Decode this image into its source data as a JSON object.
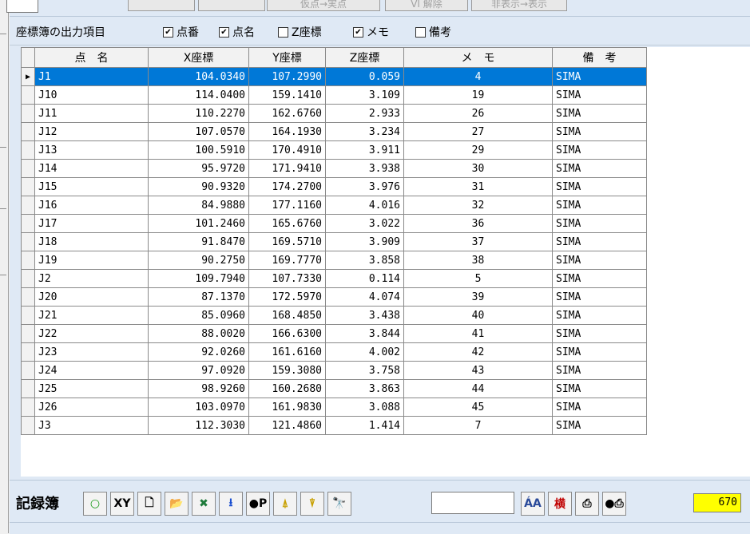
{
  "topbar": {
    "buttons": [
      "",
      "",
      "仮点→実点",
      "VI 解除",
      "非表示→表示"
    ]
  },
  "options": {
    "label": "座標簿の出力項目",
    "items": [
      {
        "label": "点番",
        "checked": true
      },
      {
        "label": "点名",
        "checked": true
      },
      {
        "label": "Z座標",
        "checked": false
      },
      {
        "label": "メモ",
        "checked": true
      },
      {
        "label": "備考",
        "checked": false
      }
    ]
  },
  "grid": {
    "headers": [
      "点　名",
      "X座標",
      "Y座標",
      "Z座標",
      "メ　モ",
      "備　考"
    ],
    "selected_indicator": "▶",
    "rows": [
      [
        "J1",
        "104.0340",
        "107.2990",
        "0.059",
        "4",
        "SIMA"
      ],
      [
        "J10",
        "114.0400",
        "159.1410",
        "3.109",
        "19",
        "SIMA"
      ],
      [
        "J11",
        "110.2270",
        "162.6760",
        "2.933",
        "26",
        "SIMA"
      ],
      [
        "J12",
        "107.0570",
        "164.1930",
        "3.234",
        "27",
        "SIMA"
      ],
      [
        "J13",
        "100.5910",
        "170.4910",
        "3.911",
        "29",
        "SIMA"
      ],
      [
        "J14",
        "95.9720",
        "171.9410",
        "3.938",
        "30",
        "SIMA"
      ],
      [
        "J15",
        "90.9320",
        "174.2700",
        "3.976",
        "31",
        "SIMA"
      ],
      [
        "J16",
        "84.9880",
        "177.1160",
        "4.016",
        "32",
        "SIMA"
      ],
      [
        "J17",
        "101.2460",
        "165.6760",
        "3.022",
        "36",
        "SIMA"
      ],
      [
        "J18",
        "91.8470",
        "169.5710",
        "3.909",
        "37",
        "SIMA"
      ],
      [
        "J19",
        "90.2750",
        "169.7770",
        "3.858",
        "38",
        "SIMA"
      ],
      [
        "J2",
        "109.7940",
        "107.7330",
        "0.114",
        "5",
        "SIMA"
      ],
      [
        "J20",
        "87.1370",
        "172.5970",
        "4.074",
        "39",
        "SIMA"
      ],
      [
        "J21",
        "85.0960",
        "168.4850",
        "3.438",
        "40",
        "SIMA"
      ],
      [
        "J22",
        "88.0020",
        "166.6300",
        "3.844",
        "41",
        "SIMA"
      ],
      [
        "J23",
        "92.0260",
        "161.6160",
        "4.002",
        "42",
        "SIMA"
      ],
      [
        "J24",
        "97.0920",
        "159.3080",
        "3.758",
        "43",
        "SIMA"
      ],
      [
        "J25",
        "98.9260",
        "160.2680",
        "3.863",
        "44",
        "SIMA"
      ],
      [
        "J26",
        "103.0970",
        "161.9830",
        "3.088",
        "45",
        "SIMA"
      ],
      [
        "J3",
        "112.3030",
        "121.4860",
        "1.414",
        "7",
        "SIMA"
      ]
    ]
  },
  "bottombar": {
    "title": "記録簿",
    "buttons": [
      {
        "name": "circle-icon",
        "glyph": "○",
        "color": "#1a9a1a"
      },
      {
        "name": "xy-button",
        "glyph": "XY",
        "color": "#000000"
      },
      {
        "name": "new-file-icon",
        "glyph": "🗋",
        "color": "#000000"
      },
      {
        "name": "open-folder-icon",
        "glyph": "📂",
        "color": "#c89a2a"
      },
      {
        "name": "excel-icon",
        "glyph": "✖",
        "color": "#1d7a3a"
      },
      {
        "name": "download-icon",
        "glyph": "⭳",
        "color": "#1a4fd0"
      },
      {
        "name": "point-p-icon",
        "glyph": "●P",
        "color": "#000000"
      },
      {
        "name": "marker-up-icon",
        "glyph": "⍋",
        "color": "#c8a000"
      },
      {
        "name": "marker-down-icon",
        "glyph": "⍒",
        "color": "#c8a000"
      },
      {
        "name": "binoculars-icon",
        "glyph": "🔭",
        "color": "#000000"
      }
    ],
    "right_buttons": [
      {
        "name": "font-size-icon",
        "glyph": "ÁA",
        "color": "#2a4a9a"
      },
      {
        "name": "horizontal-button",
        "glyph": "横",
        "color": "#c00000"
      },
      {
        "name": "printer-icon",
        "glyph": "⎙",
        "color": "#000000"
      },
      {
        "name": "dot-printer-icon",
        "glyph": "●⎙",
        "color": "#000000"
      }
    ],
    "search_value": "",
    "count": "670"
  },
  "colors": {
    "panel_bg": "#dfe9f5",
    "selection": "#0078d7",
    "count_bg": "#ffff00"
  }
}
